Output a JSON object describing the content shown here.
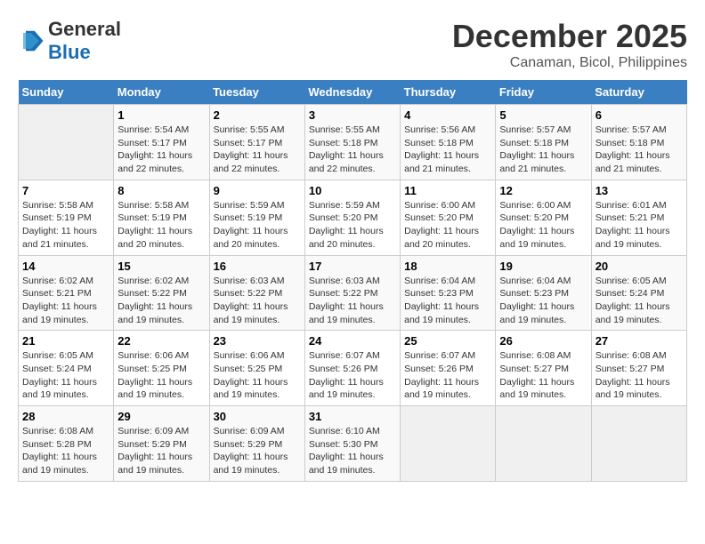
{
  "logo": {
    "general": "General",
    "blue": "Blue"
  },
  "header": {
    "month": "December 2025",
    "location": "Canaman, Bicol, Philippines"
  },
  "weekdays": [
    "Sunday",
    "Monday",
    "Tuesday",
    "Wednesday",
    "Thursday",
    "Friday",
    "Saturday"
  ],
  "weeks": [
    [
      {
        "day": "",
        "info": ""
      },
      {
        "day": "1",
        "info": "Sunrise: 5:54 AM\nSunset: 5:17 PM\nDaylight: 11 hours\nand 22 minutes."
      },
      {
        "day": "2",
        "info": "Sunrise: 5:55 AM\nSunset: 5:17 PM\nDaylight: 11 hours\nand 22 minutes."
      },
      {
        "day": "3",
        "info": "Sunrise: 5:55 AM\nSunset: 5:18 PM\nDaylight: 11 hours\nand 22 minutes."
      },
      {
        "day": "4",
        "info": "Sunrise: 5:56 AM\nSunset: 5:18 PM\nDaylight: 11 hours\nand 21 minutes."
      },
      {
        "day": "5",
        "info": "Sunrise: 5:57 AM\nSunset: 5:18 PM\nDaylight: 11 hours\nand 21 minutes."
      },
      {
        "day": "6",
        "info": "Sunrise: 5:57 AM\nSunset: 5:18 PM\nDaylight: 11 hours\nand 21 minutes."
      }
    ],
    [
      {
        "day": "7",
        "info": "Sunrise: 5:58 AM\nSunset: 5:19 PM\nDaylight: 11 hours\nand 21 minutes."
      },
      {
        "day": "8",
        "info": "Sunrise: 5:58 AM\nSunset: 5:19 PM\nDaylight: 11 hours\nand 20 minutes."
      },
      {
        "day": "9",
        "info": "Sunrise: 5:59 AM\nSunset: 5:19 PM\nDaylight: 11 hours\nand 20 minutes."
      },
      {
        "day": "10",
        "info": "Sunrise: 5:59 AM\nSunset: 5:20 PM\nDaylight: 11 hours\nand 20 minutes."
      },
      {
        "day": "11",
        "info": "Sunrise: 6:00 AM\nSunset: 5:20 PM\nDaylight: 11 hours\nand 20 minutes."
      },
      {
        "day": "12",
        "info": "Sunrise: 6:00 AM\nSunset: 5:20 PM\nDaylight: 11 hours\nand 19 minutes."
      },
      {
        "day": "13",
        "info": "Sunrise: 6:01 AM\nSunset: 5:21 PM\nDaylight: 11 hours\nand 19 minutes."
      }
    ],
    [
      {
        "day": "14",
        "info": "Sunrise: 6:02 AM\nSunset: 5:21 PM\nDaylight: 11 hours\nand 19 minutes."
      },
      {
        "day": "15",
        "info": "Sunrise: 6:02 AM\nSunset: 5:22 PM\nDaylight: 11 hours\nand 19 minutes."
      },
      {
        "day": "16",
        "info": "Sunrise: 6:03 AM\nSunset: 5:22 PM\nDaylight: 11 hours\nand 19 minutes."
      },
      {
        "day": "17",
        "info": "Sunrise: 6:03 AM\nSunset: 5:22 PM\nDaylight: 11 hours\nand 19 minutes."
      },
      {
        "day": "18",
        "info": "Sunrise: 6:04 AM\nSunset: 5:23 PM\nDaylight: 11 hours\nand 19 minutes."
      },
      {
        "day": "19",
        "info": "Sunrise: 6:04 AM\nSunset: 5:23 PM\nDaylight: 11 hours\nand 19 minutes."
      },
      {
        "day": "20",
        "info": "Sunrise: 6:05 AM\nSunset: 5:24 PM\nDaylight: 11 hours\nand 19 minutes."
      }
    ],
    [
      {
        "day": "21",
        "info": "Sunrise: 6:05 AM\nSunset: 5:24 PM\nDaylight: 11 hours\nand 19 minutes."
      },
      {
        "day": "22",
        "info": "Sunrise: 6:06 AM\nSunset: 5:25 PM\nDaylight: 11 hours\nand 19 minutes."
      },
      {
        "day": "23",
        "info": "Sunrise: 6:06 AM\nSunset: 5:25 PM\nDaylight: 11 hours\nand 19 minutes."
      },
      {
        "day": "24",
        "info": "Sunrise: 6:07 AM\nSunset: 5:26 PM\nDaylight: 11 hours\nand 19 minutes."
      },
      {
        "day": "25",
        "info": "Sunrise: 6:07 AM\nSunset: 5:26 PM\nDaylight: 11 hours\nand 19 minutes."
      },
      {
        "day": "26",
        "info": "Sunrise: 6:08 AM\nSunset: 5:27 PM\nDaylight: 11 hours\nand 19 minutes."
      },
      {
        "day": "27",
        "info": "Sunrise: 6:08 AM\nSunset: 5:27 PM\nDaylight: 11 hours\nand 19 minutes."
      }
    ],
    [
      {
        "day": "28",
        "info": "Sunrise: 6:08 AM\nSunset: 5:28 PM\nDaylight: 11 hours\nand 19 minutes."
      },
      {
        "day": "29",
        "info": "Sunrise: 6:09 AM\nSunset: 5:29 PM\nDaylight: 11 hours\nand 19 minutes."
      },
      {
        "day": "30",
        "info": "Sunrise: 6:09 AM\nSunset: 5:29 PM\nDaylight: 11 hours\nand 19 minutes."
      },
      {
        "day": "31",
        "info": "Sunrise: 6:10 AM\nSunset: 5:30 PM\nDaylight: 11 hours\nand 19 minutes."
      },
      {
        "day": "",
        "info": ""
      },
      {
        "day": "",
        "info": ""
      },
      {
        "day": "",
        "info": ""
      }
    ]
  ]
}
